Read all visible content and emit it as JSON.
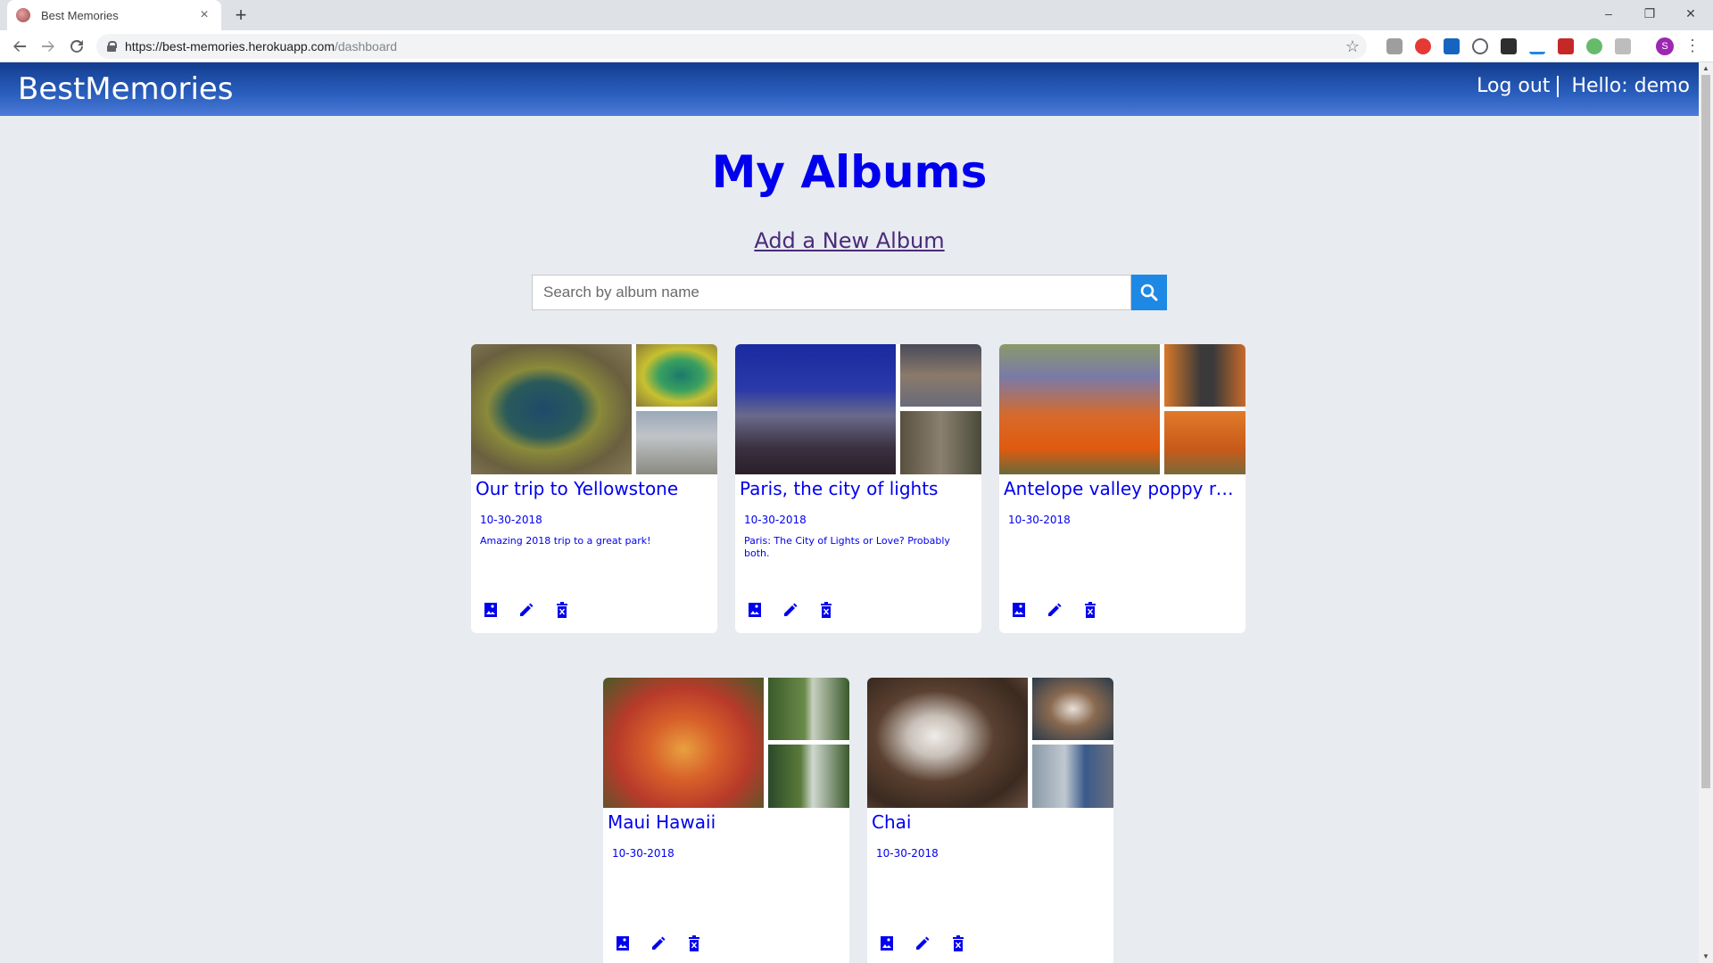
{
  "browser": {
    "tab_title": "Best Memories",
    "tab_close": "×",
    "new_tab": "+",
    "url_host": "https://best-memories.herokuapp.com",
    "url_path": "/dashboard",
    "profile_initial": "S",
    "window_controls": [
      "–",
      "❐",
      "✕"
    ]
  },
  "header": {
    "brand": "BestMemories",
    "logout": "Log out",
    "greeting": "Hello: demo"
  },
  "main": {
    "title": "My Albums",
    "add_album": "Add a New Album",
    "search_placeholder": "Search by album name"
  },
  "albums": [
    {
      "title": "Our trip to Yellowstone",
      "date": "10-30-2018",
      "description": "Amazing 2018 trip to a great park!",
      "colors": [
        "#6d7a52",
        "#3a8c5a",
        "#9aa0a8"
      ]
    },
    {
      "title": "Paris, the city of lights",
      "date": "10-30-2018",
      "description": "Paris: The City of Lights or Love? Probably both.",
      "colors": [
        "#1c2c8a",
        "#3a3a5a",
        "#6a6050"
      ]
    },
    {
      "title": "Antelope valley poppy reser…",
      "date": "10-30-2018",
      "description": "",
      "colors": [
        "#d85a1a",
        "#6a7a4a",
        "#e06a20"
      ]
    },
    {
      "title": "Maui Hawaii",
      "date": "10-30-2018",
      "description": "",
      "colors": [
        "#c8402a",
        "#4a6a2a",
        "#3a6a3a"
      ]
    },
    {
      "title": "Chai",
      "date": "10-30-2018",
      "description": "",
      "colors": [
        "#5a4030",
        "#2a3a4a",
        "#6a7080"
      ]
    }
  ],
  "theme": {
    "accent": "#0000ee",
    "header_gradient": [
      "#123d8e",
      "#4b7ad6"
    ],
    "search_button": "#1e88e5"
  }
}
